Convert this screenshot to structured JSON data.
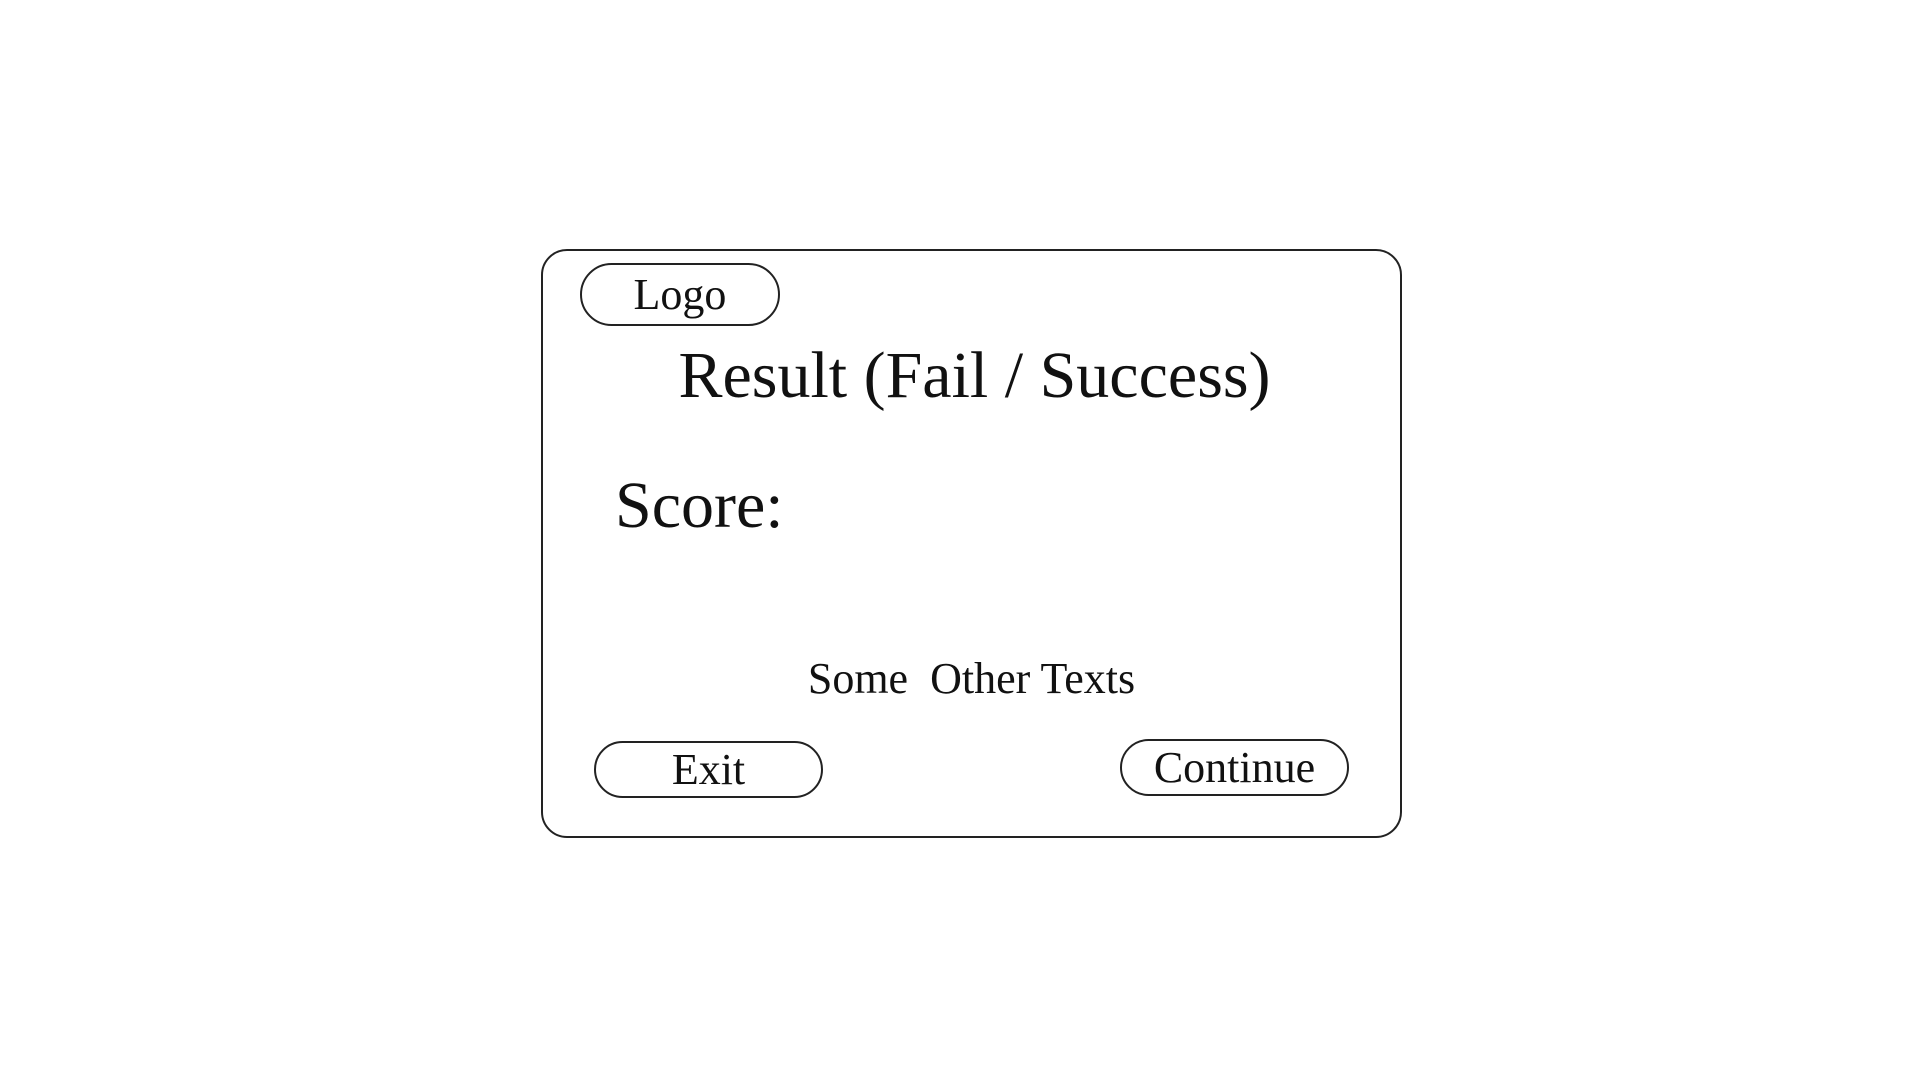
{
  "dialog": {
    "logo_text": "Logo",
    "result_title": "Result (Fail / Success)",
    "score_label": "Score:",
    "other_texts": "Some  Other Texts",
    "exit_label": "Exit",
    "continue_label": "Continue"
  }
}
